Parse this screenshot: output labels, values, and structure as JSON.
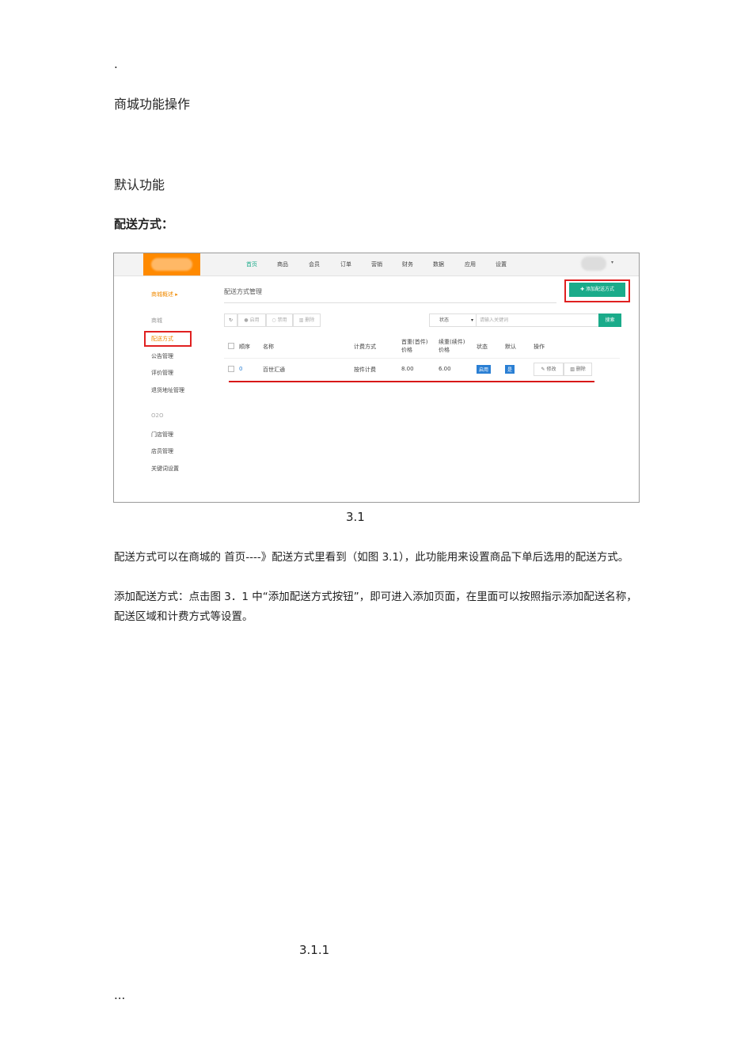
{
  "header_mark": ".",
  "footer_mark": "...",
  "doc_title": "商城功能操作",
  "section_title": "默认功能",
  "subsection_title": "配送方式：",
  "screenshot": {
    "nav": [
      "首页",
      "商品",
      "会员",
      "订单",
      "营销",
      "财务",
      "数据",
      "应用",
      "设置"
    ],
    "sidebar": {
      "overview": "商城概述 ▸",
      "group1": "商城",
      "items1": [
        "配送方式",
        "公告管理",
        "评价管理",
        "退货地址管理"
      ],
      "group2": "O2O",
      "items2": [
        "门店管理",
        "店员管理",
        "关键词设置"
      ]
    },
    "page_title": "配送方式管理",
    "add_button": "✚ 添加配送方式",
    "toolbar": {
      "refresh": "↻",
      "enable": "● 启用",
      "disable": "○ 禁用",
      "delete": "▥ 删除"
    },
    "filter": {
      "status": "状态",
      "placeholder": "请输入关键词",
      "search": "搜索"
    },
    "table": {
      "headers": [
        "顺序",
        "名称",
        "计费方式",
        "首重(首件)价格",
        "续重(续件)价格",
        "状态",
        "默认",
        "操作"
      ],
      "rows": [
        {
          "order": "0",
          "name": "百世汇通",
          "billing": "按件计费",
          "first_price": "8.00",
          "extra_price": "6.00",
          "status": "启用",
          "default": "是",
          "edit": "✎ 修改",
          "delete": "▥ 删除"
        }
      ]
    }
  },
  "caption1": "3.1",
  "paragraph1": "配送方式可以在商城的 首页----》配送方式里看到（如图 3.1），此功能用来设置商品下单后选用的配送方式。",
  "paragraph2": "添加配送方式：点击图 3．1 中“添加配送方式按钮”，即可进入添加页面，在里面可以按照指示添加配送名称，配送区域和计费方式等设置。",
  "caption2": "3.1.1"
}
